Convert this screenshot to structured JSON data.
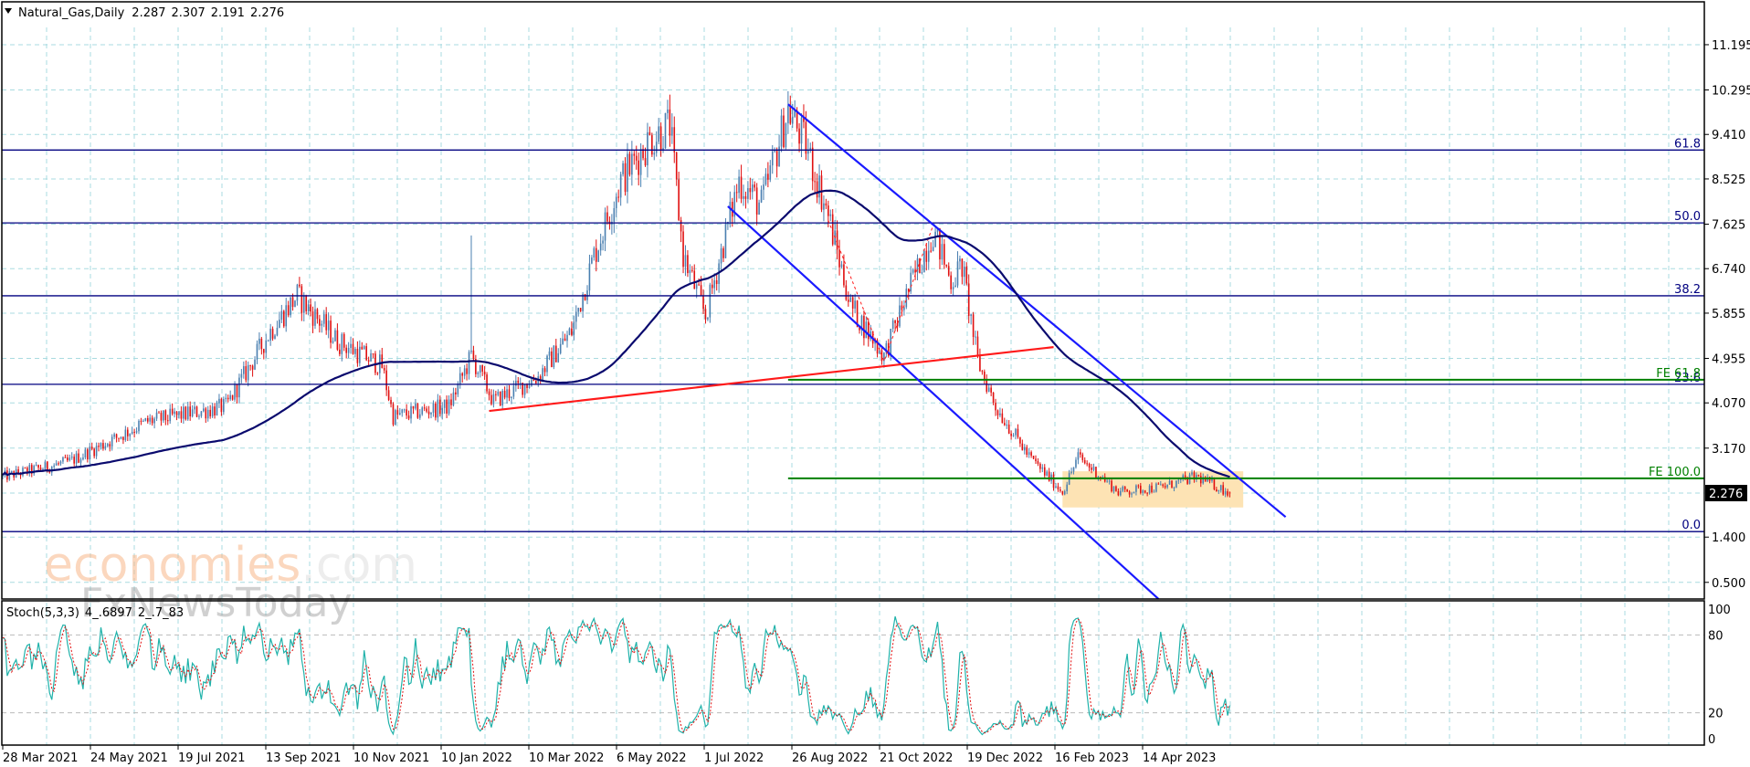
{
  "header": {
    "symbol_label": "Natural_Gas,Daily",
    "open": "2.287",
    "high": "2.307",
    "low": "2.191",
    "close": "2.276"
  },
  "indicator": {
    "label": "Stoch(5,3,3)",
    "main": "4_.6897",
    "signal": "2_.7_83"
  },
  "watermark": {
    "brand1a": "economies",
    "brand1b": ".com",
    "brand2": "FxNewsToday"
  },
  "colors": {
    "bull": "#4a7fb0",
    "bear": "#e01010",
    "ma": "#0a0a6e",
    "channel": "#1a1aff",
    "fib": "#000080",
    "fe": "#008000",
    "trend": "#ff1a1a",
    "box": "#fde3b4",
    "stoch_main": "#20b2aa",
    "stoch_signal": "#e01010",
    "grid": "#a9dbe0"
  },
  "chart_data": {
    "type": "candlestick",
    "title": "Natural_Gas,Daily",
    "last_price": 2.276,
    "y_ticks": [
      "11.195",
      "10.295",
      "9.410",
      "8.525",
      "7.625",
      "6.740",
      "5.855",
      "4.955",
      "4.070",
      "3.170",
      "1.400",
      "0.500"
    ],
    "ylim": [
      0.17,
      11.9
    ],
    "x_tick_labels": [
      "28 Mar 2021",
      "24 May 2021",
      "19 Jul 2021",
      "13 Sep 2021",
      "10 Nov 2021",
      "10 Jan 2022",
      "10 Mar 2022",
      "6 May 2022",
      "1 Jul 2022",
      "26 Aug 2022",
      "21 Oct 2022",
      "19 Dec 2022",
      "16 Feb 2023",
      "14 Apr 2023"
    ],
    "bars_per_label": 39.3,
    "price_path": [
      [
        0,
        2.6
      ],
      [
        30,
        2.9
      ],
      [
        65,
        3.7
      ],
      [
        100,
        4.0
      ],
      [
        120,
        5.5
      ],
      [
        132,
        6.2
      ],
      [
        150,
        5.3
      ],
      [
        170,
        4.8
      ],
      [
        175,
        3.8
      ],
      [
        200,
        4.0
      ],
      [
        210,
        5.0
      ],
      [
        220,
        4.1
      ],
      [
        240,
        4.6
      ],
      [
        255,
        5.5
      ],
      [
        265,
        7.0
      ],
      [
        277,
        8.5
      ],
      [
        290,
        9.3
      ],
      [
        299,
        9.6
      ],
      [
        305,
        7.0
      ],
      [
        315,
        5.8
      ],
      [
        330,
        8.5
      ],
      [
        340,
        8.0
      ],
      [
        352,
        9.9
      ],
      [
        360,
        9.2
      ],
      [
        370,
        7.8
      ],
      [
        380,
        6.0
      ],
      [
        395,
        5.0
      ],
      [
        405,
        6.2
      ],
      [
        417,
        7.5
      ],
      [
        425,
        6.5
      ],
      [
        430,
        6.8
      ],
      [
        437,
        4.9
      ],
      [
        445,
        4.0
      ],
      [
        460,
        3.0
      ],
      [
        475,
        2.3
      ],
      [
        482,
        3.0
      ],
      [
        500,
        2.3
      ],
      [
        520,
        2.4
      ],
      [
        535,
        2.6
      ],
      [
        550,
        2.28
      ]
    ],
    "spike": {
      "bar": 210,
      "high": 7.4
    },
    "ma_period": 100,
    "fib_levels": [
      {
        "label": "61.8",
        "price": 9.1
      },
      {
        "label": "50.0",
        "price": 7.65
      },
      {
        "label": "38.2",
        "price": 6.2
      },
      {
        "label": "23.6",
        "price": 4.44
      },
      {
        "label": "0.0",
        "price": 1.51
      }
    ],
    "fe_levels": [
      {
        "label": "FE 61.8",
        "price": 4.53,
        "from_bar": 352
      },
      {
        "label": "FE 100.0",
        "price": 2.57,
        "from_bar": 352
      }
    ],
    "channel_upper": [
      [
        352,
        10.01
      ],
      [
        575,
        1.8
      ]
    ],
    "channel_lower": [
      [
        325,
        7.98
      ],
      [
        518,
        0.17
      ]
    ],
    "trendline": [
      [
        218,
        3.91
      ],
      [
        471,
        5.18
      ]
    ],
    "dotted_swing": [
      [
        370,
        7.7
      ],
      [
        395,
        4.9
      ],
      [
        417,
        7.6
      ]
    ],
    "range_box": {
      "from_bar": 475,
      "to_bar": 556,
      "top": 2.71,
      "bottom": 1.99
    },
    "stoch_ticks": [
      "100",
      "80",
      "20",
      "0"
    ],
    "stoch_params": [
      5,
      3,
      3
    ]
  }
}
